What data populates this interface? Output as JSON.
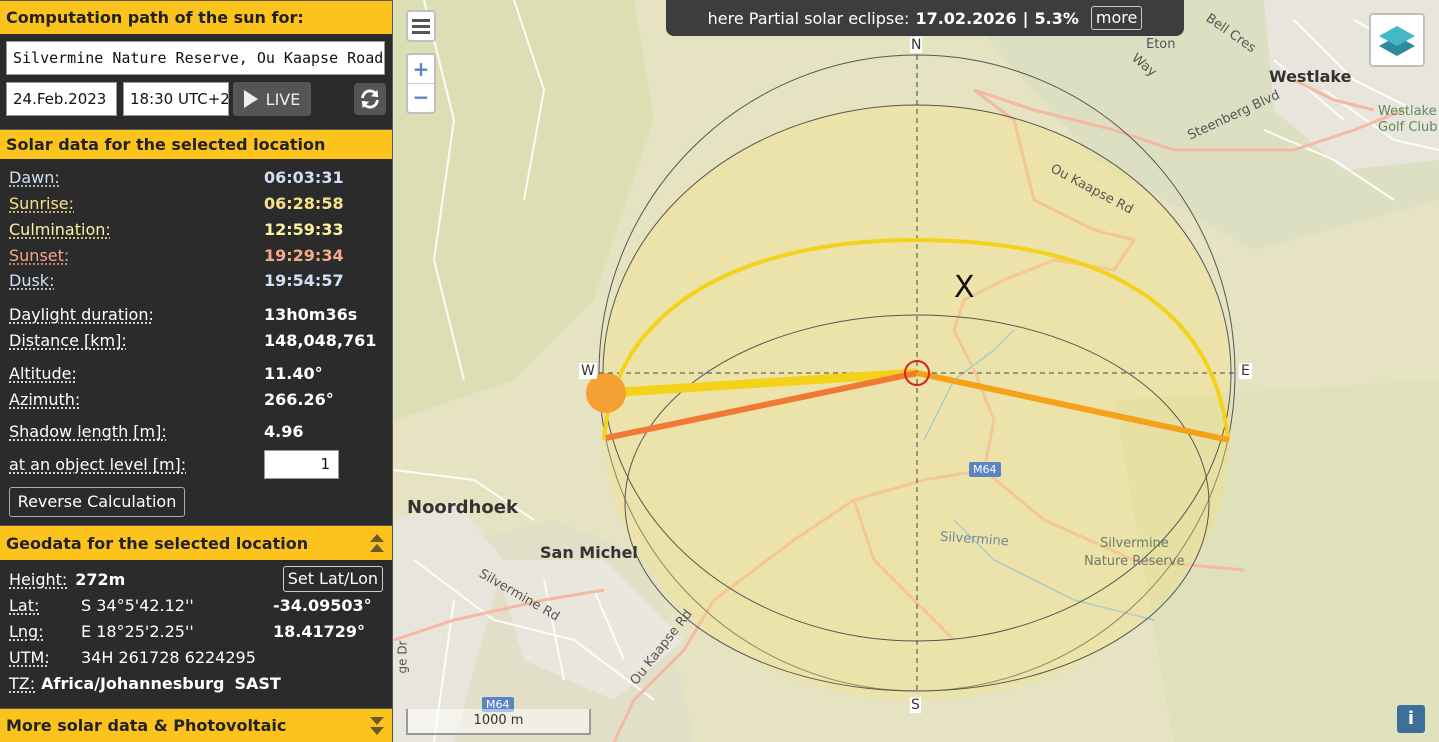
{
  "sidebar": {
    "header_title": "Computation path of the sun for:",
    "address": "Silvermine Nature Reserve, Ou Kaapse Road, Cape Town",
    "date": "24.Feb.2023",
    "time": "18:30 UTC+2",
    "live_label": "LIVE",
    "solar_title": "Solar data for the selected location",
    "solar": {
      "dawn_label": "Dawn:",
      "dawn": "06:03:31",
      "sunrise_label": "Sunrise:",
      "sunrise": "06:28:58",
      "culmination_label": "Culmination:",
      "culmination": "12:59:33",
      "sunset_label": "Sunset:",
      "sunset": "19:29:34",
      "dusk_label": "Dusk:",
      "dusk": "19:54:57",
      "daylight_label": "Daylight duration:",
      "daylight": "13h0m36s",
      "distance_label": "Distance [km]:",
      "distance": "148,048,761",
      "altitude_label": "Altitude:",
      "altitude": "11.40°",
      "azimuth_label": "Azimuth:",
      "azimuth": "266.26°",
      "shadow_label": "Shadow length [m]:",
      "shadow": "4.96",
      "object_level_label": "at an object level [m]:",
      "object_level": "1"
    },
    "reverse_label": "Reverse Calculation",
    "geo_title": "Geodata for the selected location",
    "geo": {
      "height_label": "Height:",
      "height": "272m",
      "set_latlon_label": "Set Lat/Lon",
      "lat_label": "Lat:",
      "lat_dms": "S 34°5'42.12''",
      "lat_dec": "-34.09503°",
      "lng_label": "Lng:",
      "lng_dms": "E 18°25'2.25''",
      "lng_dec": "18.41729°",
      "utm_label": "UTM:",
      "utm": "34H 261728 6224295",
      "tz_label": "TZ:",
      "tz": "Africa/Johannesburg",
      "tz_abbr": "SAST"
    },
    "more_title": "More solar data & Photovoltaic"
  },
  "map": {
    "banner_prefix": "here Partial solar eclipse:",
    "banner_date": "17.02.2026",
    "banner_sep": "|",
    "banner_pct": "5.3%",
    "more_label": "more",
    "zoom_in": "+",
    "zoom_out": "−",
    "scale_label": "1000 m",
    "info_label": "i",
    "compass": {
      "n": "N",
      "s": "S",
      "e": "E",
      "w": "W"
    },
    "marker_x": "X",
    "places": {
      "noordhoek": "Noordhoek",
      "san_michel": "San Michel",
      "westlake": "Westlake",
      "westlake_golf_1": "Westlake",
      "westlake_golf_2": "Golf Club",
      "silvermine_nr_1": "Silvermine",
      "silvermine_nr_2": "Nature Reserve",
      "silvermine": "Silvermine",
      "eton": "Eton",
      "way": "Way",
      "bell_cres": "Bell Cres",
      "steenberg": "Steenberg Blvd",
      "ou_kaapse_rd": "Ou Kaapse Rd",
      "ou_kaapse_rd_2": "Ou Kaapse Rd",
      "silvermine_rd": "Silvermine Rd",
      "m64": "M64",
      "m64_b": "M64",
      "edge_dr": "ge Dr"
    },
    "colors": {
      "sun_path": "#f5d21a",
      "sunrise_line": "#f5a21a",
      "sunset_line": "#f07a35",
      "sun": "#f5a033",
      "accent": "#fcc31d"
    }
  }
}
